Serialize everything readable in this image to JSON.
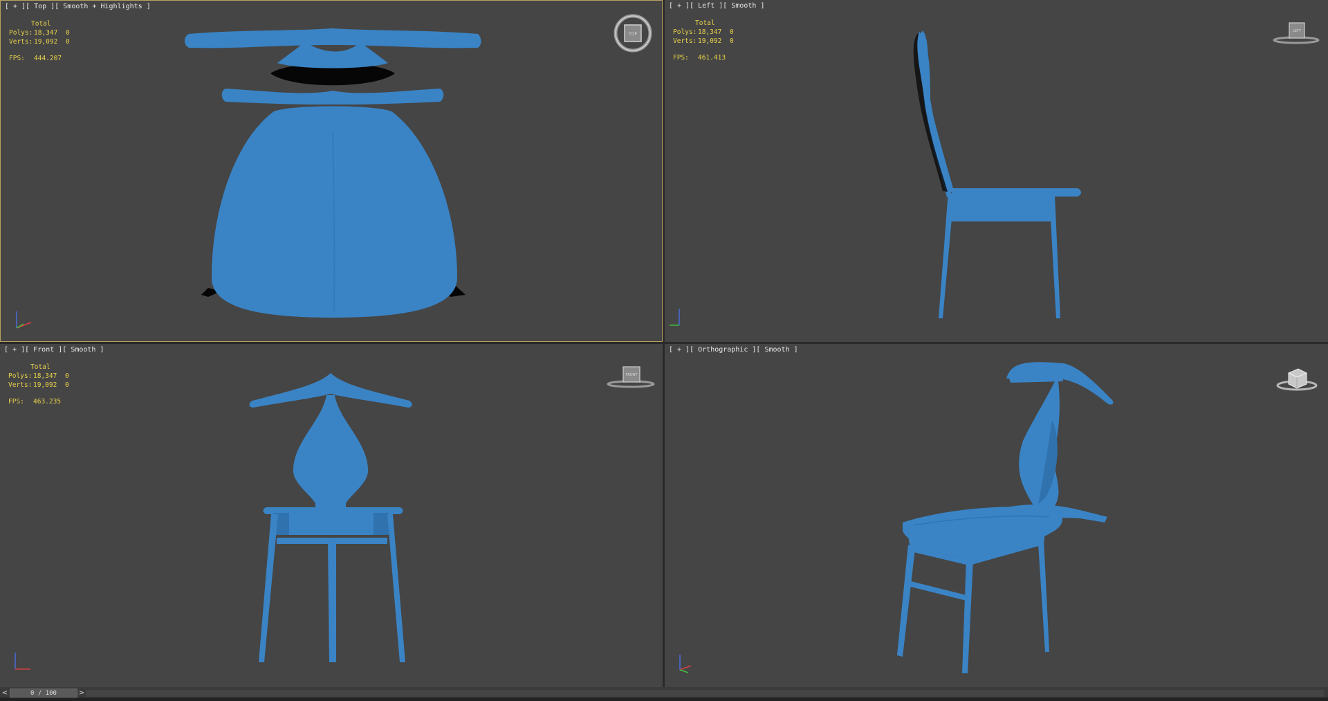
{
  "viewports": [
    {
      "label": "[ + ][ Top ][ Smooth + Highlights ]",
      "cube": "TOP",
      "stats": {
        "total": "Total",
        "polys_label": "Polys:",
        "polys": "18,347",
        "polys_sel": "0",
        "verts_label": "Verts:",
        "verts": "19,092",
        "verts_sel": "0",
        "fps_label": "FPS:",
        "fps": "444.207"
      }
    },
    {
      "label": "[ + ][ Left ][ Smooth ]",
      "cube": "LEFT",
      "stats": {
        "total": "Total",
        "polys_label": "Polys:",
        "polys": "18,347",
        "polys_sel": "0",
        "verts_label": "Verts:",
        "verts": "19,092",
        "verts_sel": "0",
        "fps_label": "FPS:",
        "fps": "461.413"
      }
    },
    {
      "label": "[ + ][ Front ][ Smooth ]",
      "cube": "FRONT",
      "stats": {
        "total": "Total",
        "polys_label": "Polys:",
        "polys": "18,347",
        "polys_sel": "0",
        "verts_label": "Verts:",
        "verts": "19,092",
        "verts_sel": "0",
        "fps_label": "FPS:",
        "fps": "463.235"
      }
    },
    {
      "label": "[ + ][ Orthographic ][ Smooth ]",
      "cube": "",
      "stats": null
    }
  ],
  "timeline": {
    "prev": "<",
    "frame": "0 / 100",
    "next": ">"
  },
  "colors": {
    "model": "#3a84c6",
    "viewport_bg": "#454545",
    "stats": "#e8d24a",
    "active_border": "#b8a060"
  },
  "icons": [
    "viewcube-icon",
    "axis-tripod-icon"
  ]
}
